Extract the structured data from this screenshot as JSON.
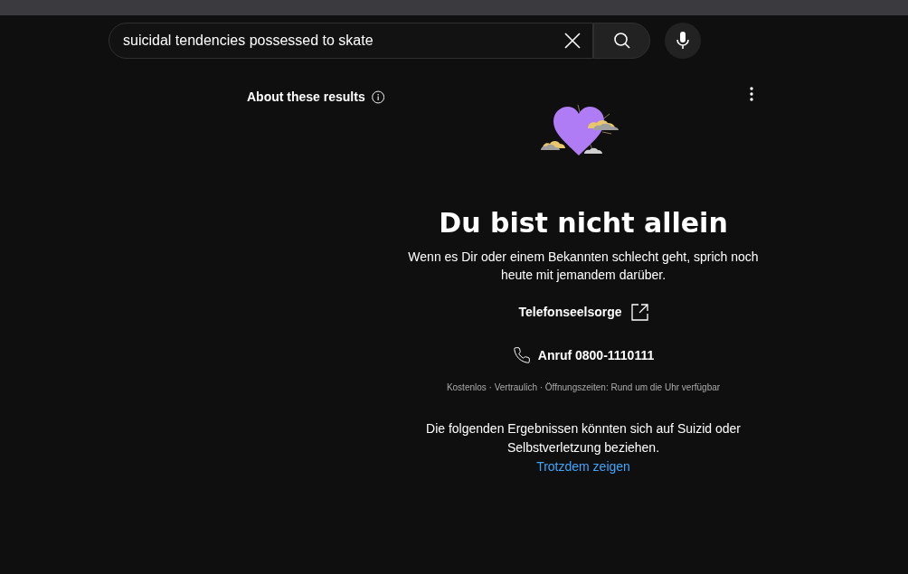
{
  "search": {
    "value": "suicidal tendencies possessed to skate"
  },
  "about": {
    "label": "About these results"
  },
  "panel": {
    "title": "Du bist nicht allein",
    "message": "Wenn es Dir oder einem Bekannten schlecht geht, sprich noch heute mit jemandem darüber.",
    "link": "Telefonseelsorge",
    "call": "Anruf 0800-1110111",
    "details": "Kostenlos · Vertraulich · Öffnungszeiten: Rund um die Uhr verfügbar",
    "warning": "Die folgenden Ergebnissen könnten sich auf Suizid oder Selbstverletzung beziehen.",
    "show_anyway": "Trotzdem zeigen"
  }
}
